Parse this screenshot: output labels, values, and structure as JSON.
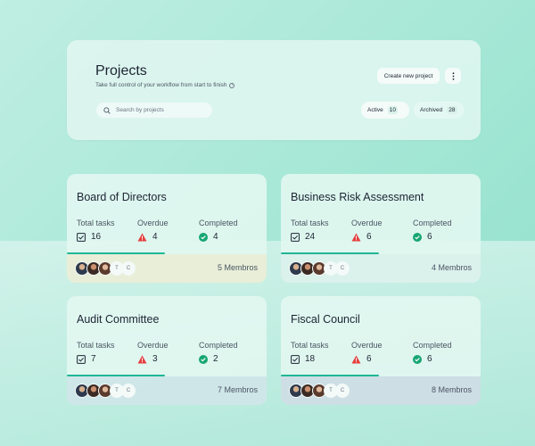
{
  "header": {
    "title": "Projects",
    "subtitle": "Take full control of your workflow from start to finish",
    "create_button": "Create new project",
    "search_placeholder": "Search by projects",
    "filters": {
      "active": {
        "label": "Active",
        "count": "10"
      },
      "archived": {
        "label": "Archived",
        "count": "28"
      }
    }
  },
  "labels": {
    "total_tasks": "Total tasks",
    "overdue": "Overdue",
    "completed": "Completed"
  },
  "projects": [
    {
      "name": "Board of Directors",
      "total": "16",
      "overdue": "4",
      "completed": "4",
      "members": "5 Membros",
      "progress": 0.49,
      "initials": [
        "T",
        "C"
      ]
    },
    {
      "name": "Business Risk Assessment",
      "total": "24",
      "overdue": "6",
      "completed": "6",
      "members": "4 Membros",
      "progress": 0.49,
      "initials": [
        "T",
        "C"
      ]
    },
    {
      "name": "Audit Committee",
      "total": "7",
      "overdue": "3",
      "completed": "2",
      "members": "7 Membros",
      "progress": 0.49,
      "initials": [
        "T",
        "C"
      ]
    },
    {
      "name": "Fiscal Council",
      "total": "18",
      "overdue": "6",
      "completed": "6",
      "members": "8 Membros",
      "progress": 0.49,
      "initials": [
        "T",
        "C"
      ]
    }
  ],
  "colors": {
    "accent": "#20b795",
    "warning": "#e53e3e",
    "success": "#17a673"
  }
}
